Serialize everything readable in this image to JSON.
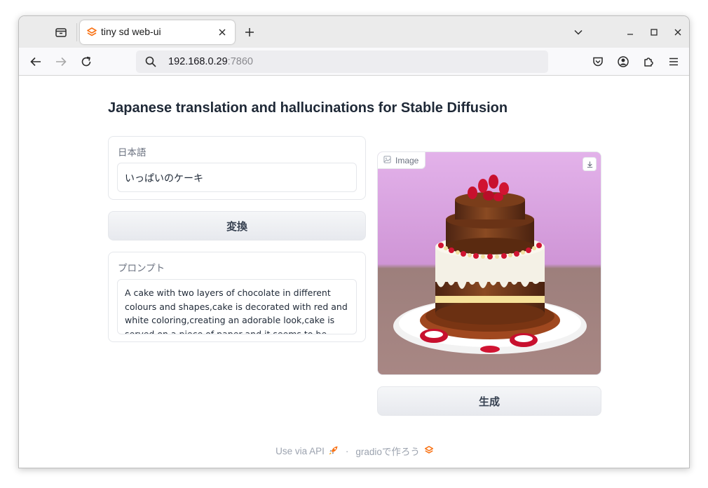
{
  "browser": {
    "tab_title": "tiny sd web-ui",
    "url_host": "192.168.0.29",
    "url_port": ":7860"
  },
  "page": {
    "title": "Japanese translation and hallucinations for Stable Diffusion",
    "japanese_block": {
      "label": "日本語",
      "value": "いっぱいのケーキ"
    },
    "convert_button": "変換",
    "prompt_block": {
      "label": "プロンプト",
      "value": "A cake with two layers of chocolate in different colours and shapes,cake is decorated with red and white coloring,creating an adorable look,cake is served on a piece of paper and it seems to be gourmet choice for"
    },
    "image_block": {
      "label": "Image"
    },
    "generate_button": "生成",
    "footer": {
      "api_link": "Use via API",
      "separator": "·",
      "built_with": "gradioで作ろう"
    }
  },
  "colors": {
    "accent": "#f97316",
    "image_background": "#d8a6e0"
  },
  "icons": {
    "tab_list": "tab-list-icon",
    "favicon": "gradio-logo-icon",
    "search": "search-icon",
    "rocket": "rocket-icon"
  }
}
